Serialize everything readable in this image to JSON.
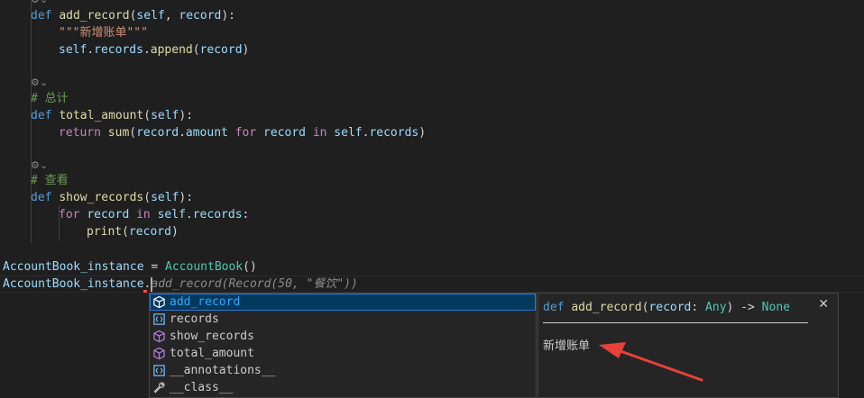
{
  "code": {
    "line1": {
      "kw": "def",
      "name": "add_record",
      "open": "(",
      "self": "self",
      "comma": ", ",
      "param": "record",
      "close": "):"
    },
    "line2": {
      "doc": "\"\"\"新增账单\"\"\""
    },
    "line3": {
      "obj": "self",
      "dot1": ".",
      "attr": "records",
      "dot2": ".",
      "method": "append",
      "open": "(",
      "arg": "record",
      "close": ")"
    },
    "comment1": "# 总计",
    "line5": {
      "kw": "def",
      "name": "total_amount",
      "open": "(",
      "self": "self",
      "close": "):"
    },
    "line6": {
      "ret": "return",
      "fn": "sum",
      "open": "(",
      "var": "record",
      "dot": ".",
      "attr": "amount",
      "for": "for",
      "var2": "record",
      "in": "in",
      "self": "self",
      "dot2": ".",
      "attr2": "records",
      "close": ")"
    },
    "comment2": "# 查看",
    "line8": {
      "kw": "def",
      "name": "show_records",
      "open": "(",
      "self": "self",
      "close": "):"
    },
    "line9": {
      "for": "for",
      "var": "record",
      "in": "in",
      "self": "self",
      "dot": ".",
      "attr": "records",
      "colon": ":"
    },
    "line10": {
      "fn": "print",
      "open": "(",
      "arg": "record",
      "close": ")"
    },
    "line11": {
      "var": "AccountBook_instance",
      "eq": " = ",
      "cls": "AccountBook",
      "call": "()"
    },
    "line12": {
      "var": "AccountBook_instance",
      "dot": ".",
      "ghost": "add_record(Record(50, \"餐饮\"))"
    }
  },
  "suggest": {
    "items": [
      {
        "label": "add_record",
        "match": "add_record",
        "kind": "method"
      },
      {
        "label": "records",
        "match": "",
        "kind": "field"
      },
      {
        "label": "show_records",
        "match": "",
        "kind": "method"
      },
      {
        "label": "total_amount",
        "match": "",
        "kind": "method"
      },
      {
        "label": "__annotations__",
        "match": "",
        "kind": "field"
      },
      {
        "label": "__class__",
        "match": "",
        "kind": "property"
      }
    ]
  },
  "details": {
    "kw": "def",
    "name": "add_record",
    "open": "(",
    "param": "record",
    "colon": ": ",
    "ptype": "Any",
    "arrow": ") -> ",
    "rtype": "None",
    "close_glyph": "✕",
    "doc": "新增账单"
  },
  "colors": {
    "background": "#1f1f1f",
    "selection": "#04395e",
    "match_highlight": "#2aaaff",
    "arrow": "#e8413a"
  }
}
